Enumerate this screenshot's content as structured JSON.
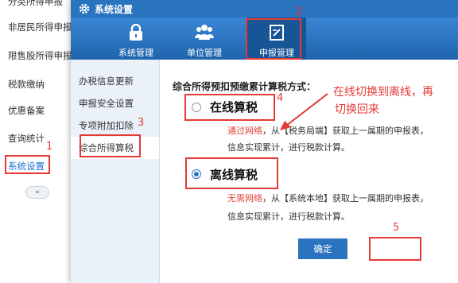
{
  "app_sidebar": {
    "items": [
      {
        "label": "分类所得申报"
      },
      {
        "label": "非居民所得申报"
      },
      {
        "label": "限售股所得申报"
      },
      {
        "label": "税款缴纳"
      },
      {
        "label": "优惠备案"
      },
      {
        "label": "查询统计"
      },
      {
        "label": "系统设置"
      }
    ],
    "collapse_glyph": "«"
  },
  "dialog": {
    "title": "系统设置",
    "toolbar": [
      {
        "label": "系统管理",
        "icon": "lock-icon"
      },
      {
        "label": "单位管理",
        "icon": "users-icon"
      },
      {
        "label": "申报管理",
        "icon": "report-edit-icon"
      }
    ],
    "menu": [
      {
        "label": "办税信息更新"
      },
      {
        "label": "申报安全设置"
      },
      {
        "label": "专项附加扣除"
      },
      {
        "label": "综合所得算税"
      }
    ],
    "content": {
      "heading": "综合所得预扣预缴累计算税方式：",
      "online": {
        "title": "在线算税",
        "lead": "通过网络",
        "rest": "，从【税务局端】获取上一属期的申报表，",
        "line2": "信息实现累计，进行税款计算。",
        "checked": false
      },
      "offline": {
        "title": "离线算税",
        "lead": "无需网络",
        "rest": "，从【系统本地】获取上一属期的申报表，",
        "line2": "信息实现累计，进行税款计算。",
        "checked": true
      },
      "confirm_label": "确定"
    }
  },
  "annotations": {
    "steps": [
      "1",
      "2",
      "3",
      "4",
      "5"
    ],
    "note_line1": "在线切换到离线，再",
    "note_line2": "切换回来",
    "color": "#e53935"
  },
  "colors": {
    "primary": "#2a73bf",
    "accent_red": "#e0463c"
  }
}
